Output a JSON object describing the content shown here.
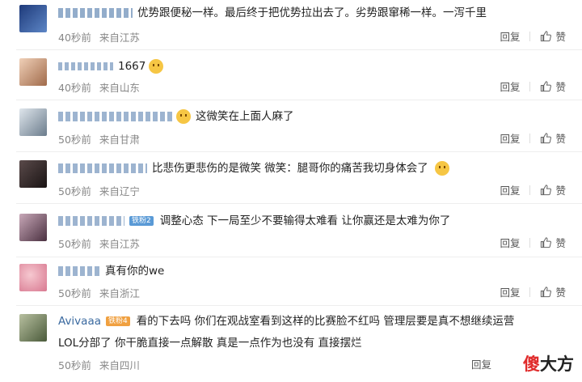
{
  "comments": [
    {
      "user": "",
      "text": "优势跟便秘一样。最后终于把优势拉出去了。劣势跟窜稀一样。一泻千里",
      "time": "40秒前",
      "source": "来自江苏",
      "reply": "回复",
      "like": "赞",
      "avatar_color": "#2b4a8a"
    },
    {
      "user": "",
      "text": "1667",
      "time": "40秒前",
      "source": "来自山东",
      "reply": "回复",
      "like": "赞",
      "avatar_color": "#b87a55"
    },
    {
      "user": "",
      "text": "这微笑在上面人麻了",
      "time": "50秒前",
      "source": "来自甘肃",
      "reply": "回复",
      "like": "赞",
      "avatar_color": "#8a9aa8"
    },
    {
      "user": "",
      "text": "比悲伤更悲伤的是微笑 微笑：腿哥你的痛苦我切身体会了",
      "time": "50秒前",
      "source": "来自辽宁",
      "reply": "回复",
      "like": "赞",
      "avatar_color": "#3a3030"
    },
    {
      "user": "",
      "badge": "铁粉2",
      "text": "调整心态 下一局至少不要输得太难看 让你赢还是太难为你了",
      "time": "50秒前",
      "source": "来自江苏",
      "reply": "回复",
      "like": "赞",
      "avatar_color": "#6a4a5a"
    },
    {
      "user": "",
      "text": "真有你的we",
      "time": "50秒前",
      "source": "来自浙江",
      "reply": "回复",
      "like": "赞",
      "avatar_color": "#d88a9a"
    },
    {
      "user": "Avivaaa",
      "badge": "铁粉4",
      "text": "看的下去吗 你们在观战室看到这样的比赛脸不红吗 管理层要是真不想继续运营",
      "text2": "LOL分部了 你干脆直接一点解散 真是一点作为也没有 直接摆烂",
      "time": "50秒前",
      "source": "来自四川",
      "reply": "回复",
      "like": "",
      "avatar_color": "#7a8a6a"
    }
  ],
  "watermark": {
    "red": "傻",
    "black": "大方"
  },
  "colors": {
    "link": "#3b6aa0",
    "badge_blue": "#5a9ad6",
    "badge_orange": "#f0a040"
  }
}
